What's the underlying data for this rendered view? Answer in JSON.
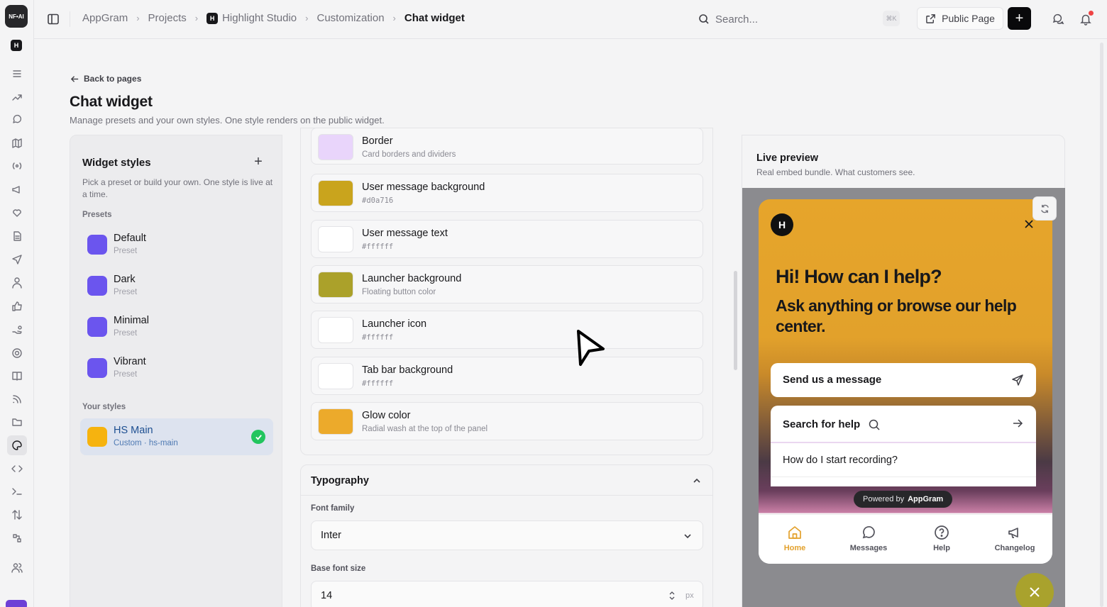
{
  "rail": {
    "logo_text": "NF•AI",
    "workspace_letter": "H",
    "icons": [
      "list-icon",
      "trend-icon",
      "chat-icon",
      "map-icon",
      "broadcast-icon",
      "megaphone-icon",
      "heart-icon",
      "document-icon",
      "send-icon",
      "user-icon",
      "thumbs-up-icon",
      "hand-coins-icon",
      "lifebuoy-icon",
      "book-icon",
      "rss-icon",
      "folder-icon",
      "palette-icon",
      "code-icon",
      "terminal-icon",
      "sort-icon",
      "workflow-icon",
      "users-icon"
    ],
    "active_icon": "palette-icon"
  },
  "topbar": {
    "breadcrumbs": [
      "AppGram",
      "Projects",
      "Highlight Studio",
      "Customization"
    ],
    "project_badge": "H",
    "current": "Chat widget",
    "search_placeholder": "Search...",
    "search_shortcut": "⌘K",
    "public_page_label": "Public Page",
    "new_label": "+"
  },
  "header": {
    "back_label": "Back to pages",
    "title": "Chat widget",
    "subtitle": "Manage presets and your own styles. One style renders on the public widget."
  },
  "styles_panel": {
    "title": "Widget styles",
    "add_label": "+",
    "description": "Pick a preset or build your own. One style is live at a time.",
    "presets_label": "Presets",
    "presets": [
      {
        "name": "Default",
        "sub": "Preset",
        "color": "#6b55ee"
      },
      {
        "name": "Dark",
        "sub": "Preset",
        "color": "#6b55ee"
      },
      {
        "name": "Minimal",
        "sub": "Preset",
        "color": "#6b55ee"
      },
      {
        "name": "Vibrant",
        "sub": "Preset",
        "color": "#6b55ee"
      }
    ],
    "custom_label": "Your styles",
    "custom": [
      {
        "name": "HS Main",
        "sub": "Custom · hs-main",
        "color": "#f6b30f",
        "selected": true
      }
    ]
  },
  "colors": [
    {
      "name": "Border",
      "desc": "Card borders and dividers",
      "color": "#e9d5fb",
      "mono": false
    },
    {
      "name": "User message background",
      "desc": "#d0a716",
      "color": "#c9a41d",
      "mono": true
    },
    {
      "name": "User message text",
      "desc": "#ffffff",
      "color": "#ffffff",
      "mono": true
    },
    {
      "name": "Launcher background",
      "desc": "Floating button color",
      "color": "#aba12a",
      "mono": false
    },
    {
      "name": "Launcher icon",
      "desc": "#ffffff",
      "color": "#ffffff",
      "mono": true
    },
    {
      "name": "Tab bar background",
      "desc": "#ffffff",
      "color": "#ffffff",
      "mono": true
    },
    {
      "name": "Glow color",
      "desc": "Radial wash at the top of the panel",
      "color": "#ecaa2b",
      "mono": false
    }
  ],
  "typography": {
    "title": "Typography",
    "font_family_label": "Font family",
    "font_family_value": "Inter",
    "base_size_label": "Base font size",
    "base_size_value": "14",
    "base_size_unit": "px"
  },
  "preview": {
    "title": "Live preview",
    "subtitle": "Real embed bundle. What customers see.",
    "widget": {
      "logo_letter": "H",
      "greeting": "Hi! How can I help?",
      "greeting_sub": "Ask anything or browse our help center.",
      "send_message_label": "Send us a message",
      "search_label": "Search for help",
      "question": "How do I start recording?",
      "powered_prefix": "Powered by",
      "powered_brand": "AppGram",
      "tabs": [
        "Home",
        "Messages",
        "Help",
        "Changelog"
      ],
      "active_tab": "Home"
    }
  }
}
